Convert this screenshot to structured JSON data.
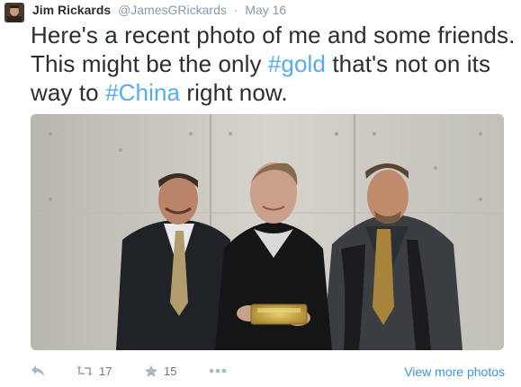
{
  "tweet": {
    "author_name": "Jim Rickards",
    "handle": "@JamesGRickards",
    "separator": "·",
    "date": "May 16",
    "text_parts": {
      "p1": "Here's a recent photo of me and some friends. This might be the only ",
      "hashtag1": "#gold",
      "p2": " that's not on its way to ",
      "hashtag2": "#China",
      "p3": " right now."
    },
    "photo_icon": "photo-of-three-men-holding-gold-bar",
    "actions": {
      "reply_icon": "reply-icon",
      "retweet_icon": "retweet-icon",
      "retweet_count": "17",
      "favorite_icon": "star-icon",
      "favorite_count": "15",
      "more_icon": "ellipsis-icon",
      "view_more": "View more photos"
    }
  },
  "colors": {
    "hashtag": "#55acee",
    "link": "#3b94d9",
    "muted": "#8899a6",
    "text": "#292f33"
  }
}
